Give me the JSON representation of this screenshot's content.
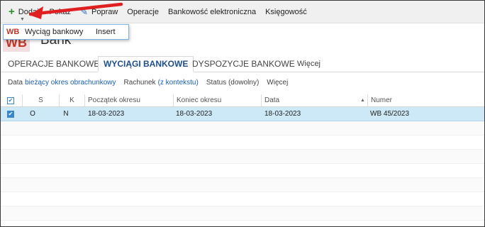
{
  "toolbar": {
    "add_label": "Dodaj",
    "show_label": "Pokaż",
    "edit_label": "Popraw",
    "operations_label": "Operacje",
    "ebanking_label": "Bankowość elektroniczna",
    "accounting_label": "Księgowość"
  },
  "dropdown": {
    "item_icon": "WB",
    "item_label": "Wyciąg bankowy",
    "item_shortcut": "Insert"
  },
  "header": {
    "logo_text": "WB",
    "title": "Bank"
  },
  "tabs": [
    {
      "label": "OPERACJE BANKOWE",
      "active": false
    },
    {
      "label": "WYCIĄGI BANKOWE",
      "active": true
    },
    {
      "label": "DYSPOZYCJE BANKOWE",
      "active": false
    },
    {
      "label": "Więcej",
      "active": false
    }
  ],
  "filters": {
    "data_label": "Data",
    "data_value": "bieżący okres obrachunkowy",
    "account_label": "Rachunek",
    "account_value": "(z kontekstu)",
    "status_label": "Status (dowolny)",
    "more_label": "Więcej"
  },
  "grid": {
    "columns": [
      "S",
      "K",
      "Początek okresu",
      "Koniec okresu",
      "Data",
      "Numer"
    ],
    "rows": [
      {
        "checked": true,
        "s": "O",
        "k": "N",
        "start": "18-03-2023",
        "end": "18-03-2023",
        "date": "18-03-2023",
        "number": "WB 45/2023"
      }
    ]
  },
  "colors": {
    "accent": "#1f4f8a",
    "link": "#1a5fb4",
    "selected_row": "#cde8f7",
    "arrow": "#e02020",
    "brand": "#c0392b"
  },
  "icons": [
    "plus-icon",
    "brush-icon",
    "chevron-down-icon",
    "checkbox-icon",
    "sort-descending-icon",
    "arrow-annotation"
  ]
}
